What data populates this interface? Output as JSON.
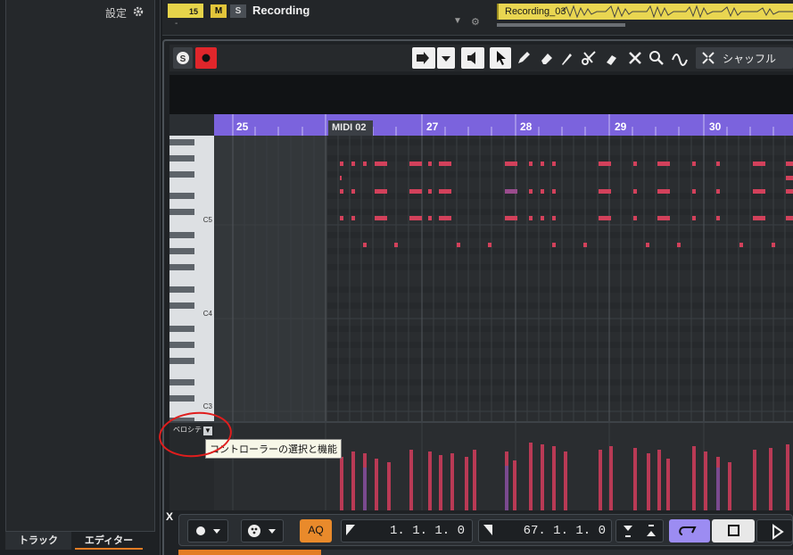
{
  "left_panel": {
    "settings_label": "設定",
    "tabs": [
      {
        "label": "トラック"
      },
      {
        "label": "エディター"
      }
    ]
  },
  "track": {
    "number": "15",
    "mute": "M",
    "solo": "S",
    "name": "Recording",
    "sub": "-",
    "clip_name": "Recording_03"
  },
  "toolbar": {
    "shuffle_label": "シャッフル"
  },
  "ruler": {
    "bars": [
      "25",
      "27",
      "28",
      "29",
      "30"
    ],
    "part_label": "MIDI 02"
  },
  "piano": {
    "labels": [
      "C5",
      "C4",
      "C3"
    ]
  },
  "velocity": {
    "lane_label": "ベロシテ",
    "tooltip": "コントローラーの選択と機能"
  },
  "transport": {
    "close": "X",
    "aq": "AQ",
    "left_locator": "1. 1. 1. 0",
    "right_locator": "67. 1. 1. 0"
  },
  "colors": {
    "note": "#d2415b",
    "ruler": "#7b63dd",
    "record": "#e0262b",
    "aq": "#e98a2b",
    "cycle": "#9c8cf2"
  }
}
